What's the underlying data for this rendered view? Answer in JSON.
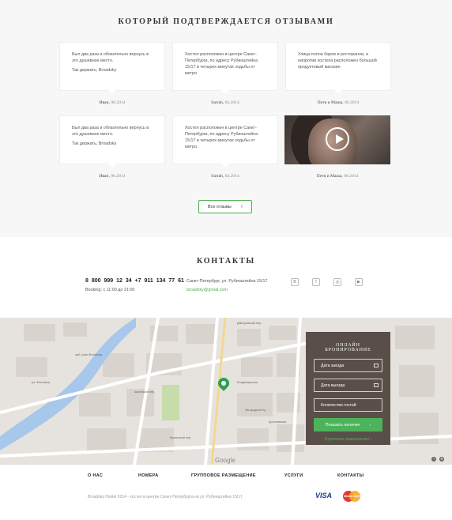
{
  "reviews": {
    "title": "Который подтверждается отзывами",
    "cards": [
      {
        "text": "Был два раза и обязательно вернусь в это душевное место.",
        "sign": "Так держать, Broadsky",
        "author": "Иван,",
        "date": "06.2014"
      },
      {
        "text": "Хостел расположен в центре Санкт-Петербурга, по адресу Рубинштейна 15/17 в четырех минутах ходьбы от метро.",
        "sign": "",
        "author": "Sarrah,",
        "date": "04.2014"
      },
      {
        "text": "Улица полна баров и ресторанов, а напротив хостела расположен большой продуктовый магазин",
        "sign": "",
        "author": "Петя и Маша,",
        "date": "06.2014"
      },
      {
        "text": "Был два раза и обязательно вернусь в это душевное место.",
        "sign": "Так держать, Broadsky",
        "author": "Иван,",
        "date": "06.2014"
      },
      {
        "text": "Хостел расположен в центре Санкт-Петербурга, по адресу Рубинштейна 15/17 в четырех минутах ходьбы от метро.",
        "sign": "",
        "author": "Sarrah,",
        "date": "04.2014"
      }
    ],
    "video_author": "Петя и Маша,",
    "video_date": "06.2014",
    "all_button": "Все отзывы"
  },
  "contacts": {
    "title": "КОНТАКТЫ",
    "phones": "8 800 999 12 34   +7 911 134 77 61",
    "hours": "Booking: с 11:00 до 21:00",
    "address": "Санкт-Петербург, ул. Рубинштейна 15/17",
    "email": "broadsky@gmail.com",
    "social": [
      {
        "icon": "vk-icon",
        "glyph": "В"
      },
      {
        "icon": "facebook-icon",
        "glyph": "f"
      },
      {
        "icon": "instagram-icon",
        "glyph": "◎"
      },
      {
        "icon": "youtube-icon",
        "glyph": "▶"
      }
    ]
  },
  "map": {
    "labels": [
      "ул. Фонтанка",
      "наб. реки Фонтанки",
      "Дмитровский пер.",
      "Щербаков пер.",
      "Загородный пр.",
      "Достоевская",
      "Владимирская",
      "Кузнечный пер."
    ],
    "google": "Google"
  },
  "booking": {
    "title": "Онлайн бронирование",
    "check_in": "Дата заезда",
    "check_out": "Дата выезда",
    "guests": "Количество гостей",
    "submit": "Показать наличие",
    "group_link": "Групповое размещение"
  },
  "footer": {
    "nav": [
      "О НАС",
      "НОМЕРА",
      "ГРУППОВОЕ РАЗМЕЩЕНИЕ",
      "УСЛУГИ",
      "КОНТАКТЫ"
    ],
    "copyright": "Broadsky Hostel 2014 - хостел в центре Санкт-Петербурга на ул. Рубинштейна 15/17",
    "visa": "VISA",
    "mastercard": "MasterCard"
  },
  "colors": {
    "accent": "#4cae4c",
    "panel": "#5a4f48",
    "water": "#a7c7eb"
  }
}
